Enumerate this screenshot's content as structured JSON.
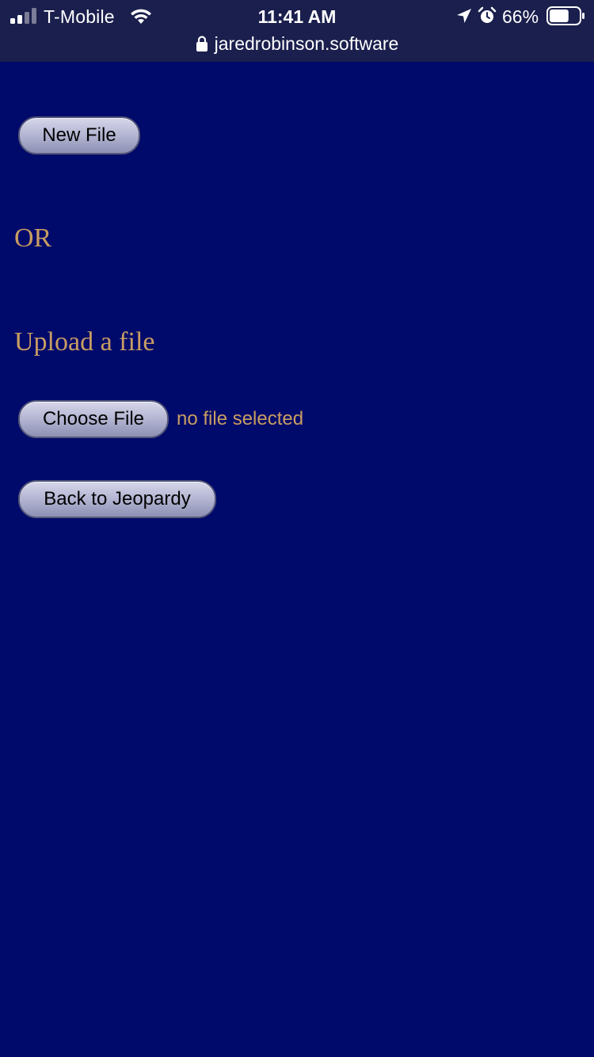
{
  "status_bar": {
    "carrier": "T-Mobile",
    "time": "11:41 AM",
    "battery_percent": "66%",
    "battery_level": 0.66,
    "signal_bars_active": 2,
    "signal_bars_total": 4
  },
  "browser": {
    "url": "jaredrobinson.software"
  },
  "main": {
    "new_file_label": "New File",
    "or_label": "OR",
    "upload_heading": "Upload a file",
    "choose_file_label": "Choose File",
    "file_status": "no file selected",
    "back_label": "Back to Jeopardy"
  },
  "colors": {
    "background": "#000a6b",
    "topbar": "#1a1f4d",
    "accent_text": "#c99d63"
  }
}
